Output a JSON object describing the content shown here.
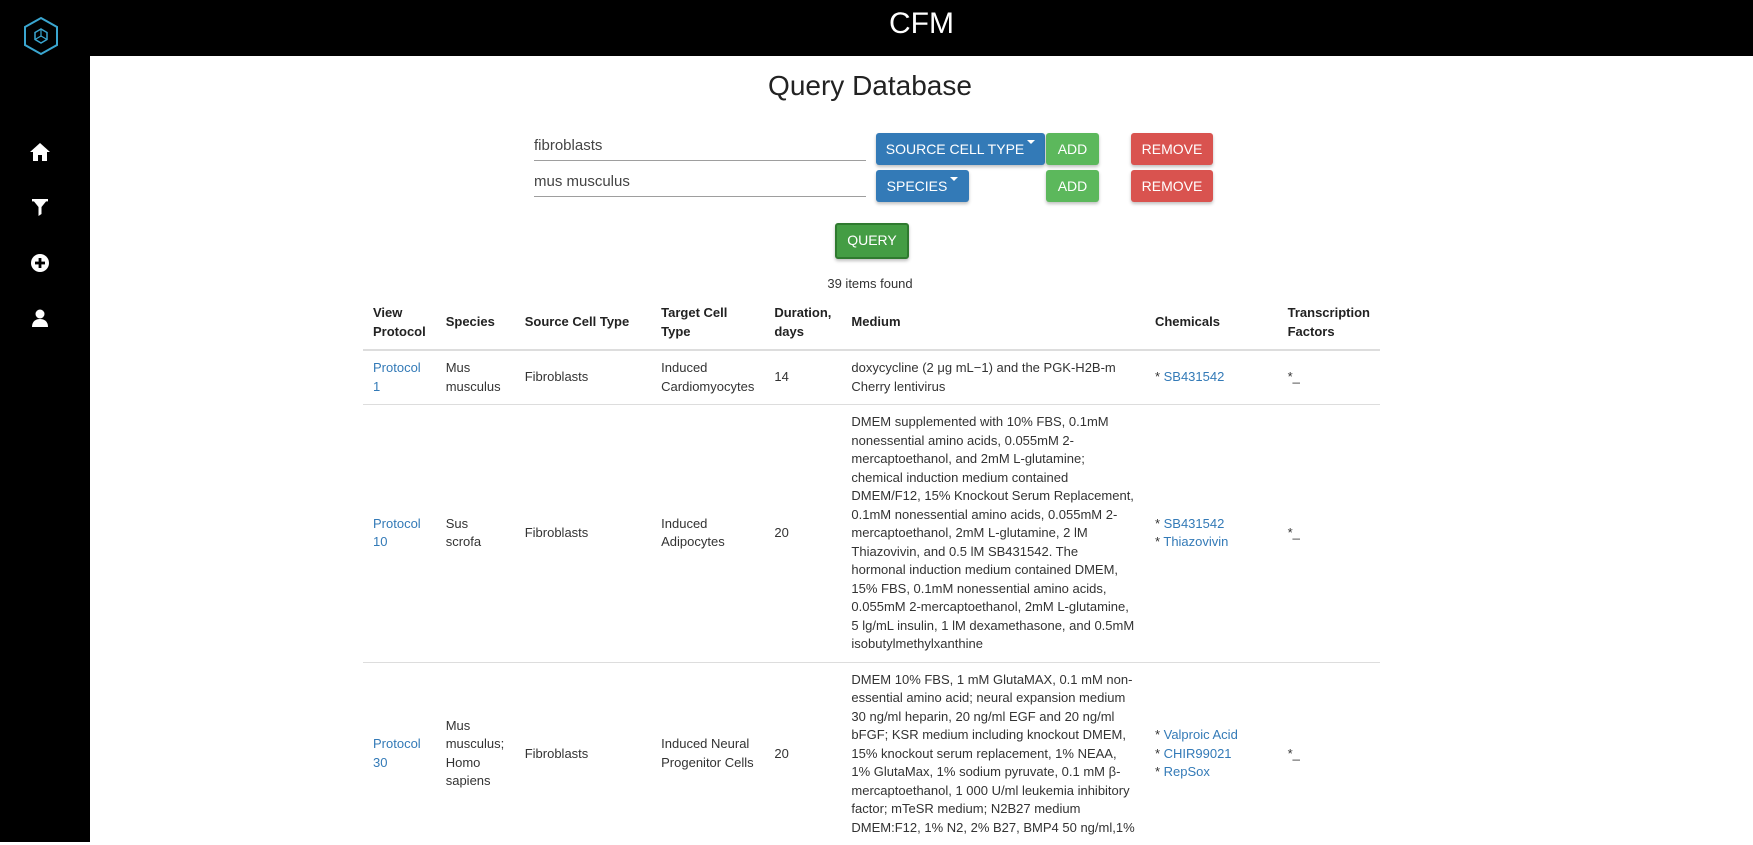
{
  "header": {
    "title": "CFM"
  },
  "sidebar": {
    "items": [
      {
        "name": "home",
        "icon": "home-icon"
      },
      {
        "name": "filter",
        "icon": "filter-icon"
      },
      {
        "name": "add",
        "icon": "add-circle-icon"
      },
      {
        "name": "user",
        "icon": "user-icon"
      }
    ]
  },
  "page": {
    "title": "Query Database"
  },
  "filters": [
    {
      "value": "fibroblasts",
      "type_label": "SOURCE CELL TYPE",
      "add_label": "ADD",
      "remove_label": "REMOVE"
    },
    {
      "value": "mus musculus",
      "type_label": "SPECIES",
      "add_label": "ADD",
      "remove_label": "REMOVE"
    }
  ],
  "query_button": "QUERY",
  "results_count": "39 items found",
  "table": {
    "headers": {
      "view_protocol": "View Protocol",
      "species": "Species",
      "source": "Source Cell Type",
      "target": "Target Cell Type",
      "duration": "Duration, days",
      "medium": "Medium",
      "chemicals": "Chemicals",
      "tf": "Transcription Factors"
    },
    "rows": [
      {
        "protocol": "Protocol 1",
        "species": "Mus musculus",
        "source": "Fibroblasts",
        "target": "Induced Cardiomyocytes",
        "duration": "14",
        "medium": "doxycycline (2 μg mL−1) and the PGK-H2B-m Cherry lentivirus",
        "chemicals": [
          "SB431542"
        ],
        "tf": "*_"
      },
      {
        "protocol": "Protocol 10",
        "species": "Sus scrofa",
        "source": "Fibroblasts",
        "target": "Induced Adipocytes",
        "duration": "20",
        "medium": "DMEM supplemented with 10% FBS, 0.1mM nonessential amino acids, 0.055mM 2-mercaptoethanol, and 2mM L-glutamine; chemical induction medium contained DMEM/F12, 15% Knockout Serum Replacement, 0.1mM nonessential amino acids, 0.055mM 2-mercaptoethanol, 2mM L-glutamine, 2 lM Thiazovivin, and 0.5 lM SB431542. The hormonal induction medium contained DMEM, 15% FBS, 0.1mM nonessential amino acids, 0.055mM 2-mercaptoethanol, 2mM L-glutamine, 5 lg/mL insulin, 1 lM dexamethasone, and 0.5mM isobutylmethylxanthine",
        "chemicals": [
          "SB431542",
          "Thiazovivin"
        ],
        "tf": "*_"
      },
      {
        "protocol": "Protocol 30",
        "species": "Mus musculus; Homo sapiens",
        "source": "Fibroblasts",
        "target": "Induced Neural Progenitor Cells",
        "duration": "20",
        "medium": "DMEM 10% FBS, 1 mM GlutaMAX, 0.1 mM non-essential amino acid; neural expansion medium 30 ng/ml heparin, 20 ng/ml EGF and 20 ng/ml bFGF; KSR medium including knockout DMEM, 15% knockout serum replacement, 1% NEAA, 1% GlutaMax, 1% sodium pyruvate, 0.1 mM β-mercaptoethanol, 1 000 U/ml leukemia inhibitory factor; mTeSR medium; N2B27 medium DMEM:F12, 1% N2, 2% B27, BMP4 50 ng/ml,1%",
        "chemicals": [
          "Valproic Acid",
          "CHIR99021",
          "RepSox"
        ],
        "tf": "*_"
      }
    ]
  },
  "colors": {
    "primary": "#337ab7",
    "success": "#5cb85c",
    "danger": "#d9534f",
    "link": "#337ab7",
    "logo": "#3aa6d0"
  }
}
